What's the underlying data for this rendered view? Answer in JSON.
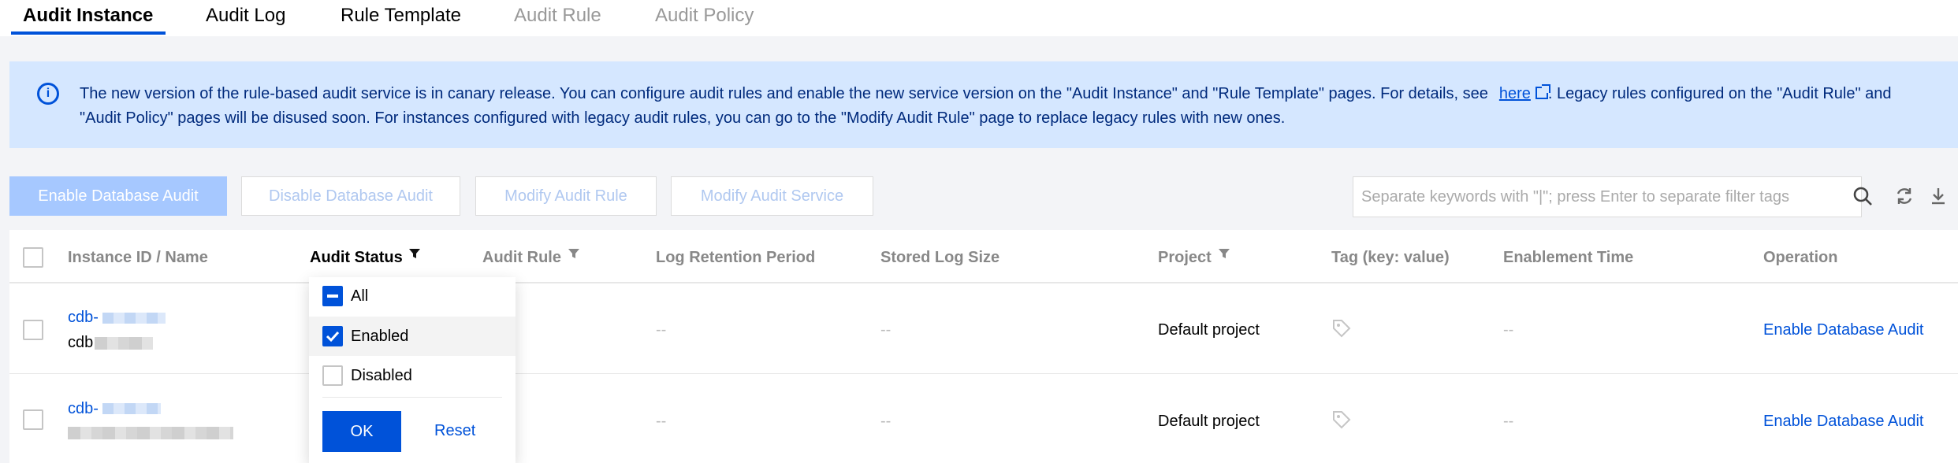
{
  "tabs": [
    {
      "label": "Audit Instance",
      "state": "active"
    },
    {
      "label": "Audit Log",
      "state": "normal"
    },
    {
      "label": "Rule Template",
      "state": "normal"
    },
    {
      "label": "Audit Rule",
      "state": "disabled"
    },
    {
      "label": "Audit Policy",
      "state": "disabled"
    }
  ],
  "notice": {
    "icon": "info-icon",
    "text_before": "The new version of the rule-based audit service is in canary release. You can configure audit rules and enable the new service version on the \"Audit Instance\" and \"Rule Template\" pages. For details, see",
    "link": "here",
    "text_after": ". Legacy rules configured on the \"Audit Rule\" and \"Audit Policy\" pages will be disused soon. For instances configured with legacy audit rules, you can go to the \"Modify Audit Rule\" page to replace legacy rules with new ones."
  },
  "toolbar": {
    "enable_label": "Enable Database Audit",
    "disable_label": "Disable Database Audit",
    "modify_rule_label": "Modify Audit Rule",
    "modify_service_label": "Modify Audit Service",
    "search_placeholder": "Separate keywords with \"|\"; press Enter to separate filter tags"
  },
  "table": {
    "headers": {
      "instance": "Instance ID / Name",
      "audit_status": "Audit Status",
      "audit_rule": "Audit Rule",
      "log_retention": "Log Retention Period",
      "stored_log": "Stored Log Size",
      "project": "Project",
      "tag": "Tag (key: value)",
      "enablement_time": "Enablement Time",
      "operation": "Operation"
    },
    "rows": [
      {
        "id": "cdb-",
        "name": "cdb",
        "log_retention": "--",
        "stored_log": "--",
        "project": "Default project",
        "enablement_time": "--",
        "operation": "Enable Database Audit"
      },
      {
        "id": "cdb-",
        "name": "",
        "log_retention": "--",
        "stored_log": "--",
        "project": "Default project",
        "enablement_time": "--",
        "operation": "Enable Database Audit"
      }
    ]
  },
  "status_filter": {
    "options": [
      {
        "label": "All",
        "state": "indeterminate"
      },
      {
        "label": "Enabled",
        "state": "checked"
      },
      {
        "label": "Disabled",
        "state": "unchecked"
      }
    ],
    "ok_label": "OK",
    "reset_label": "Reset"
  },
  "colors": {
    "primary": "#0052d9",
    "notice_bg": "#d5e7ff",
    "primary_disabled": "#a6c8ff"
  }
}
